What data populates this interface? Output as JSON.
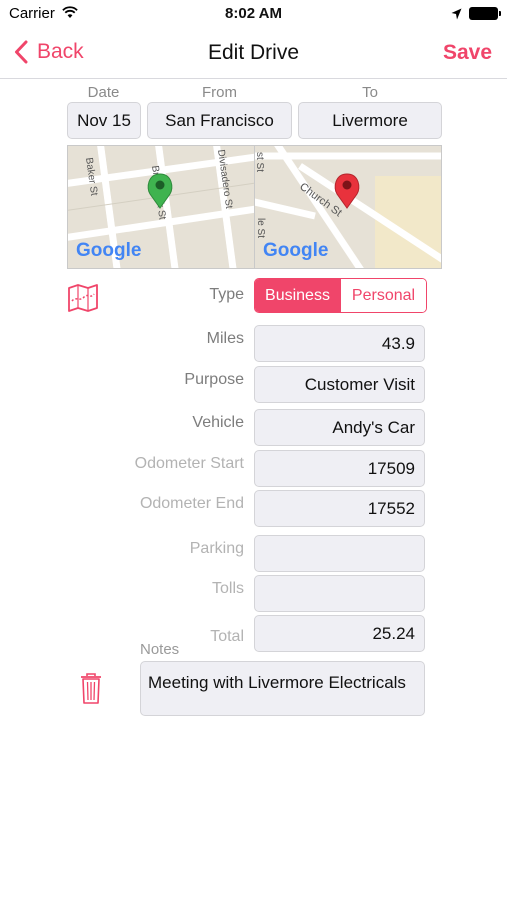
{
  "status_bar": {
    "carrier": "Carrier",
    "time": "8:02 AM"
  },
  "nav": {
    "back_label": "Back",
    "title": "Edit Drive",
    "save_label": "Save"
  },
  "trip": {
    "date_label": "Date",
    "date": "Nov 15",
    "from_label": "From",
    "from": "San Francisco",
    "to_label": "To",
    "to": "Livermore"
  },
  "maps": {
    "from_map": {
      "streets": [
        "Baker St",
        "Broderick St",
        "Divisadero St"
      ],
      "logo": "Google",
      "pin_color": "#3fb34f"
    },
    "to_map": {
      "streets": [
        "Church St",
        "st St",
        "le St"
      ],
      "logo": "Google",
      "pin_color": "#e8323c"
    }
  },
  "form": {
    "type_label": "Type",
    "type_options": [
      "Business",
      "Personal"
    ],
    "type_selected": "Business",
    "miles_label": "Miles",
    "miles": "43.9",
    "purpose_label": "Purpose",
    "purpose": "Customer Visit",
    "vehicle_label": "Vehicle",
    "vehicle": "Andy's Car",
    "odo_start_label": "Odometer Start",
    "odo_start": "17509",
    "odo_end_label": "Odometer End",
    "odo_end": "17552",
    "parking_label": "Parking",
    "parking": "",
    "tolls_label": "Tolls",
    "tolls": "",
    "total_label": "Total",
    "total": "25.24",
    "notes_label": "Notes",
    "notes": "Meeting with Livermore Electricals"
  },
  "colors": {
    "accent": "#f0456a",
    "field_bg": "#efeff4",
    "map_bg": "#e8e3d8"
  },
  "icons": [
    "wifi-icon",
    "location-arrow-icon",
    "battery-icon",
    "chevron-left-icon",
    "map-icon",
    "trash-icon",
    "map-pin-icon"
  ]
}
